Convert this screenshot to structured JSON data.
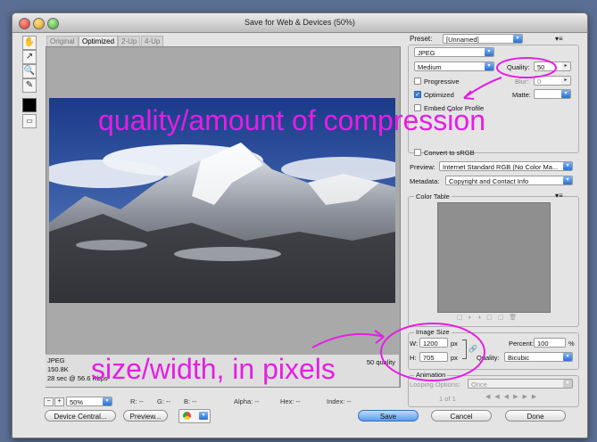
{
  "window": {
    "title": "Save for Web & Devices (50%)"
  },
  "tabs": [
    {
      "label": "Original",
      "active": false
    },
    {
      "label": "Optimized",
      "active": true
    },
    {
      "label": "2-Up",
      "active": false
    },
    {
      "label": "4-Up",
      "active": false
    }
  ],
  "tools": [
    "hand-icon",
    "slice-select-icon",
    "zoom-icon",
    "eyedropper-icon"
  ],
  "preview": {
    "format": "JPEG",
    "filesize": "150.8K",
    "time": "28 sec @ 56.6 Kbps",
    "quality_label": "50 quality"
  },
  "statusbar": {
    "zoom": "50%",
    "r": "R: --",
    "g": "G: --",
    "b": "B: --",
    "alpha": "Alpha: --",
    "hex": "Hex: --",
    "index": "Index: --"
  },
  "settings": {
    "preset_label": "Preset:",
    "preset_value": "[Unnamed]",
    "format": "JPEG",
    "quality_preset": "Medium",
    "quality_label": "Quality:",
    "quality_value": "50",
    "blur_label": "Blur:",
    "blur_value": "0",
    "matte_label": "Matte:",
    "progressive": "Progressive",
    "optimized": "Optimized",
    "embed_profile": "Embed Color Profile",
    "convert_srgb": "Convert to sRGB",
    "preview_label": "Preview:",
    "preview_value": "Internet Standard RGB (No Color Ma...",
    "metadata_label": "Metadata:",
    "metadata_value": "Copyright and Contact Info",
    "color_table": "Color Table"
  },
  "image_size": {
    "title": "Image Size",
    "w_label": "W:",
    "w_value": "1200",
    "h_label": "H:",
    "h_value": "705",
    "unit": "px",
    "percent_label": "Percent:",
    "percent_value": "100",
    "percent_unit": "%",
    "quality_label": "Quality:",
    "quality_value": "Bicubic"
  },
  "animation": {
    "title": "Animation",
    "looping_label": "Looping Options:",
    "looping_value": "Once",
    "frame": "1 of 1"
  },
  "buttons": {
    "device_central": "Device Central...",
    "preview": "Preview...",
    "save": "Save",
    "cancel": "Cancel",
    "done": "Done"
  },
  "annotations": {
    "quality": "quality/amount of compression",
    "size": "size/width, in pixels"
  },
  "colors": {
    "annotation": "#e51ee5",
    "accent": "#3b7fd9"
  }
}
